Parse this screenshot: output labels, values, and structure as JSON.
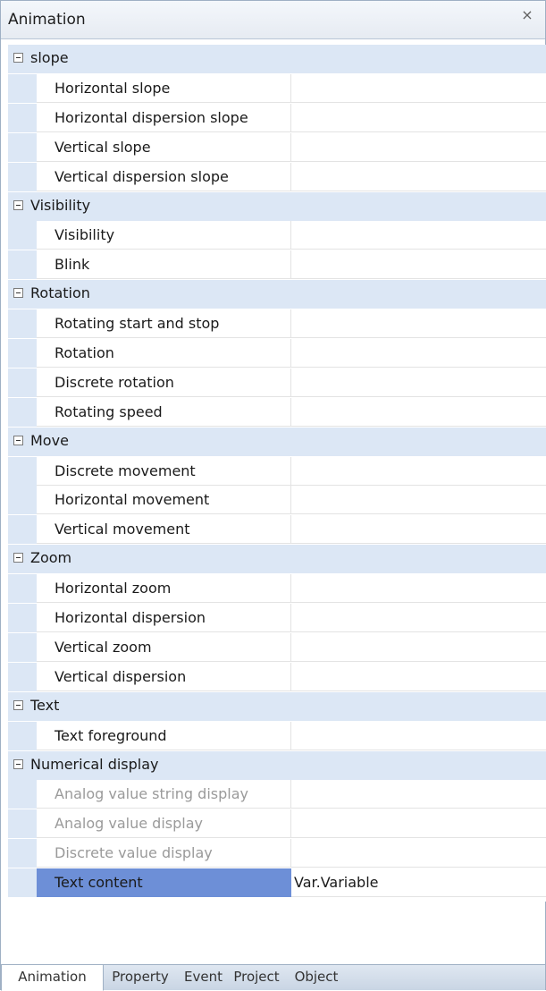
{
  "window": {
    "title": "Animation",
    "close_glyph": "×"
  },
  "categories": [
    {
      "label": "slope",
      "items": [
        {
          "name": "Horizontal slope",
          "value": ""
        },
        {
          "name": "Horizontal dispersion slope",
          "value": ""
        },
        {
          "name": "Vertical slope",
          "value": ""
        },
        {
          "name": "Vertical dispersion slope",
          "value": ""
        }
      ]
    },
    {
      "label": "Visibility",
      "items": [
        {
          "name": "Visibility",
          "value": ""
        },
        {
          "name": "Blink",
          "value": ""
        }
      ]
    },
    {
      "label": "Rotation",
      "items": [
        {
          "name": "Rotating start and stop",
          "value": ""
        },
        {
          "name": "Rotation",
          "value": ""
        },
        {
          "name": "Discrete rotation",
          "value": ""
        },
        {
          "name": "Rotating speed",
          "value": ""
        }
      ]
    },
    {
      "label": "Move",
      "items": [
        {
          "name": "Discrete movement",
          "value": ""
        },
        {
          "name": "Horizontal movement",
          "value": ""
        },
        {
          "name": "Vertical movement",
          "value": ""
        }
      ]
    },
    {
      "label": "Zoom",
      "items": [
        {
          "name": "Horizontal zoom",
          "value": ""
        },
        {
          "name": "Horizontal dispersion",
          "value": ""
        },
        {
          "name": "Vertical zoom",
          "value": ""
        },
        {
          "name": "Vertical dispersion",
          "value": ""
        }
      ]
    },
    {
      "label": "Text",
      "items": [
        {
          "name": "Text foreground",
          "value": ""
        }
      ]
    },
    {
      "label": "Numerical display",
      "items": [
        {
          "name": "Analog value string display",
          "value": "",
          "disabled": true
        },
        {
          "name": "Analog value display",
          "value": "",
          "disabled": true
        },
        {
          "name": "Discrete value display",
          "value": "",
          "disabled": true
        },
        {
          "name": "Text content",
          "value": "Var.Variable",
          "selected": true
        }
      ]
    }
  ],
  "tabs": [
    {
      "label": "Animation",
      "active": true
    },
    {
      "label": "Property"
    },
    {
      "label": "Event"
    },
    {
      "label": "Project"
    },
    {
      "label": "Object"
    }
  ]
}
